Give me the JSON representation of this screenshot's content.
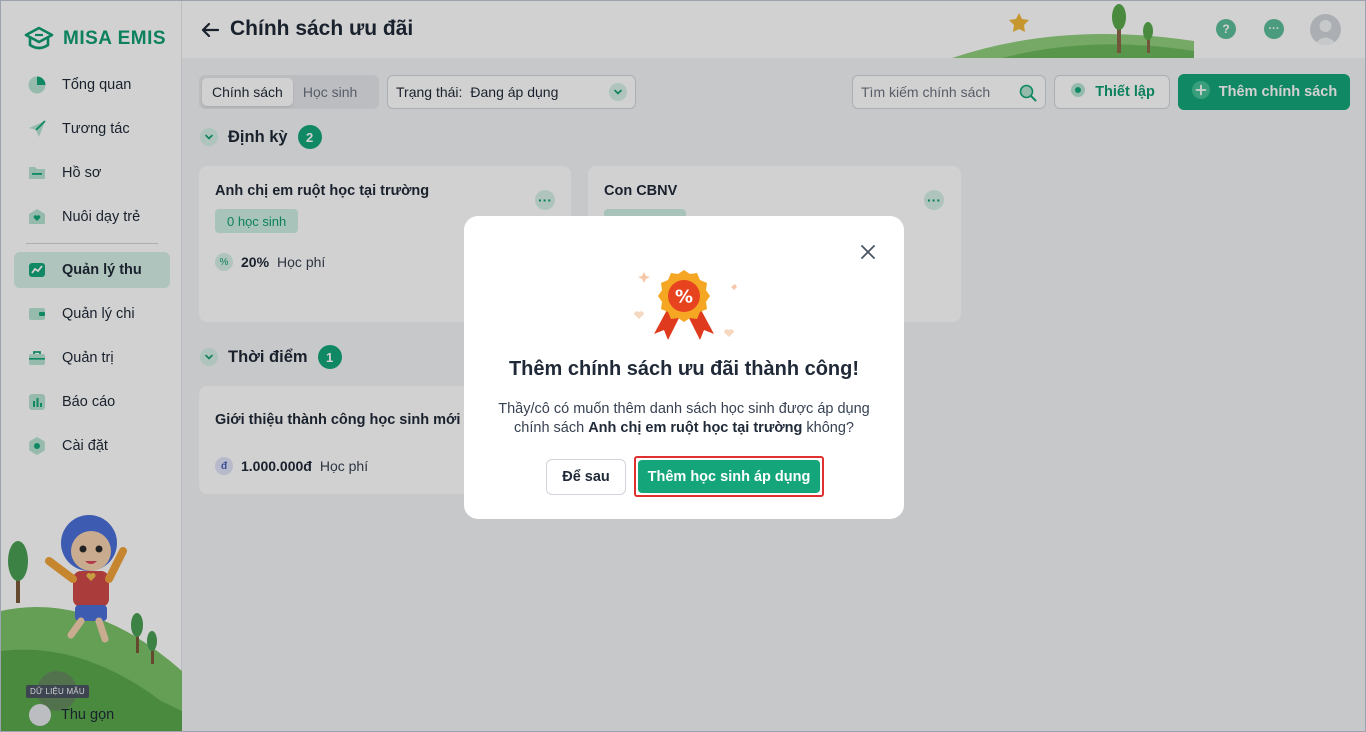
{
  "app": {
    "logo_text": "MISA EMIS",
    "sample_badge": "DỮ LIỆU MẪU"
  },
  "sidebar": {
    "items": [
      {
        "label": "Tổng quan",
        "icon": "pie-chart-icon"
      },
      {
        "label": "Tương tác",
        "icon": "paper-plane-icon"
      },
      {
        "label": "Hồ sơ",
        "icon": "folder-icon"
      },
      {
        "label": "Nuôi dạy trẻ",
        "icon": "heart-home-icon"
      },
      {
        "label": "Quản lý thu",
        "icon": "trend-chart-icon",
        "active": true
      },
      {
        "label": "Quản lý chi",
        "icon": "wallet-icon"
      },
      {
        "label": "Quản trị",
        "icon": "briefcase-icon"
      },
      {
        "label": "Báo cáo",
        "icon": "bar-chart-icon"
      },
      {
        "label": "Cài đặt",
        "icon": "gear-icon"
      }
    ],
    "collapse_label": "Thu gọn"
  },
  "header": {
    "title": "Chính sách ưu đãi",
    "help_icon": "?",
    "more_icon": "···"
  },
  "toolbar": {
    "tabs": [
      {
        "label": "Chính sách",
        "selected": true
      },
      {
        "label": "Học sinh",
        "selected": false
      }
    ],
    "status_label": "Trạng thái:",
    "status_value": "Đang áp dụng",
    "search_placeholder": "Tìm kiếm chính sách",
    "setup_label": "Thiết lập",
    "add_label": "Thêm chính sách"
  },
  "sections": [
    {
      "title": "Định kỳ",
      "count": "2",
      "cards": [
        {
          "title": "Anh chị em ruột học tại trường",
          "students": "0 học sinh",
          "value": "20%",
          "unit": "Học phí"
        },
        {
          "title": "Con CBNV",
          "students": "",
          "value": "",
          "unit": ""
        }
      ]
    },
    {
      "title": "Thời điểm",
      "count": "1",
      "cards": [
        {
          "title": "Giới thiệu thành công học sinh mới",
          "value": "1.000.000đ",
          "unit": "Học phí"
        }
      ]
    }
  ],
  "modal": {
    "title": "Thêm chính sách ưu đãi thành công!",
    "body_prefix": "Thầy/cô có muốn thêm danh sách học sinh được áp dụng chính sách",
    "body_policy": "Anh chị em ruột học tại trường",
    "body_suffix": "không?",
    "badge_symbol": "%",
    "later_label": "Để sau",
    "confirm_label": "Thêm học sinh áp dụng"
  },
  "colors": {
    "brand": "#14a67a",
    "brand_light": "#d6f0e6",
    "highlight_border": "#e03131"
  }
}
